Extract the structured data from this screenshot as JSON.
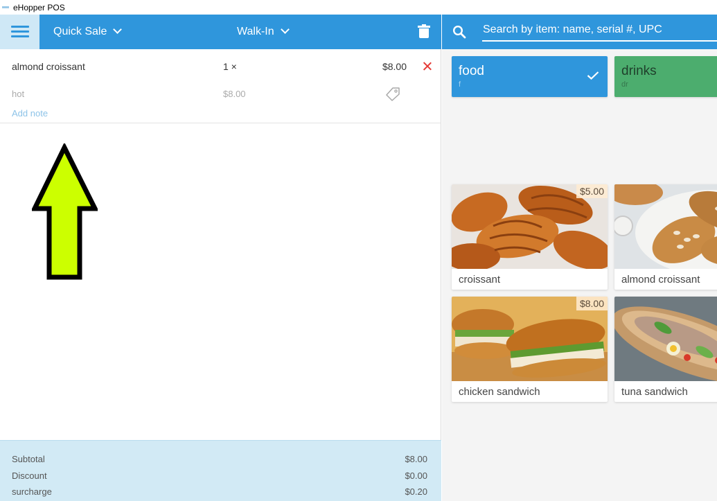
{
  "window": {
    "title": "eHopper POS"
  },
  "header": {
    "sale_type": "Quick Sale",
    "customer": "Walk-In"
  },
  "cart": {
    "items": [
      {
        "name": "almond croissant",
        "qty": "1 ×",
        "price": "$8.00",
        "modifier": "hot",
        "modifier_price": "$8.00",
        "add_note": "Add note"
      }
    ]
  },
  "totals": {
    "subtotal_label": "Subtotal",
    "subtotal_value": "$8.00",
    "discount_label": "Discount",
    "discount_value": "$0.00",
    "surcharge_label": "surcharge",
    "surcharge_value": "$0.20"
  },
  "search": {
    "placeholder": "Search by item: name, serial #, UPC"
  },
  "categories": [
    {
      "name": "food",
      "key": "f",
      "selected": true,
      "color": "#2f96dc"
    },
    {
      "name": "drinks",
      "key": "dr",
      "selected": false,
      "color": "#4cad6e"
    }
  ],
  "products": [
    {
      "name": "croissant",
      "price": "$5.00"
    },
    {
      "name": "almond croissant",
      "price": ""
    },
    {
      "name": "chicken sandwich",
      "price": "$8.00"
    },
    {
      "name": "tuna sandwich",
      "price": ""
    }
  ],
  "colors": {
    "accent": "#2f96dc",
    "arrow_fill": "#ccff00",
    "remove": "#e53935"
  }
}
